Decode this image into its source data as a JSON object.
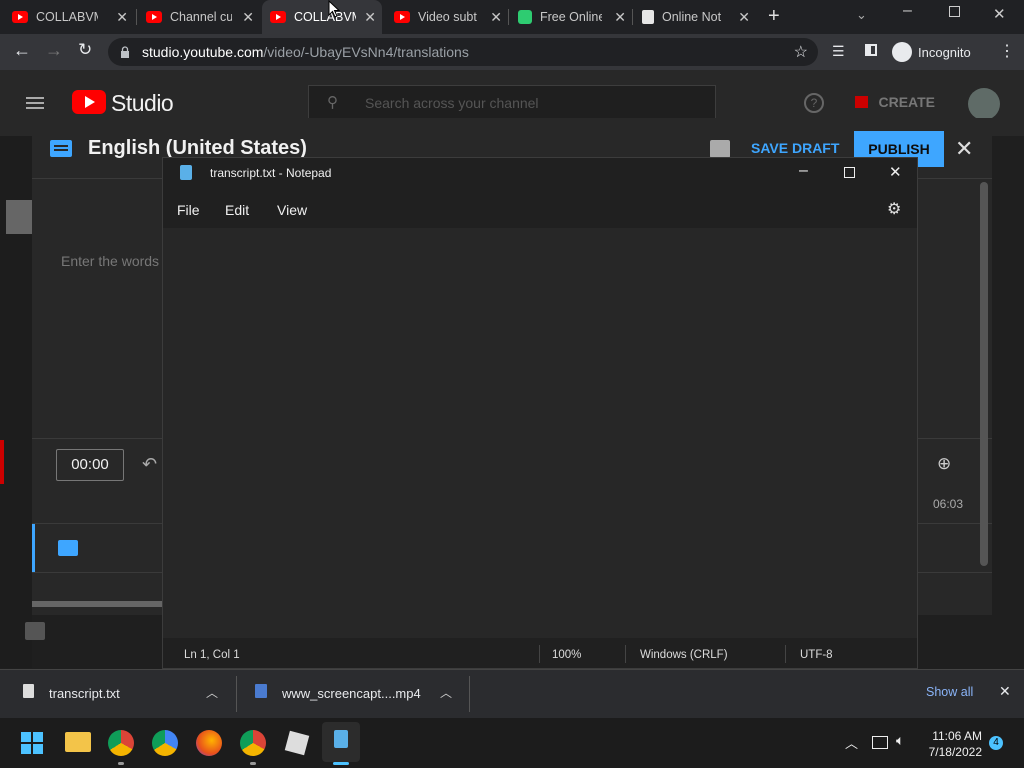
{
  "browser": {
    "tabs": [
      {
        "title": "COLLABVM",
        "icon": "youtube-icon"
      },
      {
        "title": "Channel cu",
        "icon": "youtube-icon"
      },
      {
        "title": "COLLABVM",
        "icon": "youtube-icon"
      },
      {
        "title": "Video subt",
        "icon": "youtube-icon"
      },
      {
        "title": "Free Online",
        "icon": "green-app-icon"
      },
      {
        "title": "Online Not",
        "icon": "notepad-icon"
      }
    ],
    "url_host": "studio.youtube.com",
    "url_path": "/video/-UbayEVsNn4/translations",
    "profile_label": "Incognito"
  },
  "studio": {
    "logo_text": "Studio",
    "search_placeholder": "Search across your channel",
    "create_label": "CREATE",
    "dialog_title": "English (United States)",
    "save_draft_label": "SAVE DRAFT",
    "publish_label": "PUBLISH",
    "editor_placeholder": "Enter the words",
    "time_current": "00:00",
    "time_end": "06:03"
  },
  "notepad": {
    "title": "transcript.txt - Notepad",
    "menu": [
      "File",
      "Edit",
      "View"
    ],
    "status_position": "Ln 1, Col 1",
    "status_zoom": "100%",
    "status_eol": "Windows (CRLF)",
    "status_encoding": "UTF-8"
  },
  "downloads": {
    "items": [
      {
        "name": "transcript.txt"
      },
      {
        "name": "www_screencapt....mp4"
      }
    ],
    "show_all_label": "Show all"
  },
  "taskbar": {
    "time": "11:06 AM",
    "date": "7/18/2022",
    "notification_count": "4"
  },
  "colors": {
    "accent_blue": "#3ea6ff",
    "youtube_red": "#ff0000",
    "notepad_bg": "#272727"
  }
}
